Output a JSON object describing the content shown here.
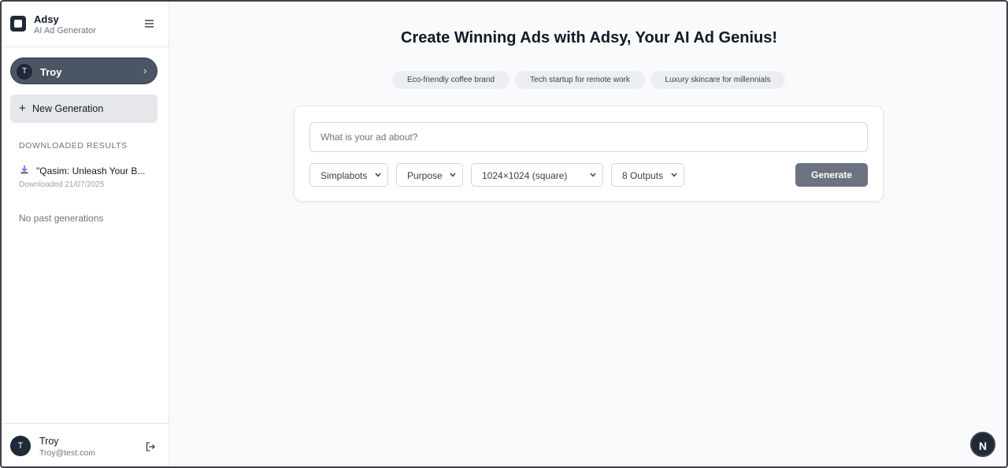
{
  "brand": {
    "name": "Adsy",
    "subtitle": "AI Ad Generator"
  },
  "user_pill": {
    "avatar_initial": "T",
    "name": "Troy"
  },
  "sidebar": {
    "new_generation_label": "New Generation",
    "downloaded_heading": "DOWNLOADED RESULTS",
    "downloaded_items": [
      {
        "title": "\"Qasim: Unleash Your B...",
        "date": "Downloaded 21/07/2025"
      }
    ],
    "no_past_text": "No past generations"
  },
  "footer_user": {
    "avatar_initial": "T",
    "name": "Troy",
    "email": "Troy@test.com"
  },
  "main": {
    "title_prefix": "Create Winning Ads with ",
    "title_highlight": "Adsy",
    "title_suffix": ", Your AI Ad Genius!",
    "suggestions": [
      "Eco-friendly coffee brand",
      "Tech startup for remote work",
      "Luxury skincare for millennials"
    ],
    "prompt_placeholder": "What is your ad about?",
    "prompt_value": "",
    "selects": {
      "brand": "Simplabots",
      "purpose": "Purpose",
      "size": "1024×1024 (square)",
      "outputs": "8 Outputs"
    },
    "generate_label": "Generate"
  },
  "badge": {
    "letter": "N"
  },
  "colors": {
    "sidebar_bg": "#ffffff",
    "main_bg": "#f8fafc",
    "pill_bg": "#4b5563",
    "button_gray": "#6b7280",
    "dark": "#1f2937"
  }
}
